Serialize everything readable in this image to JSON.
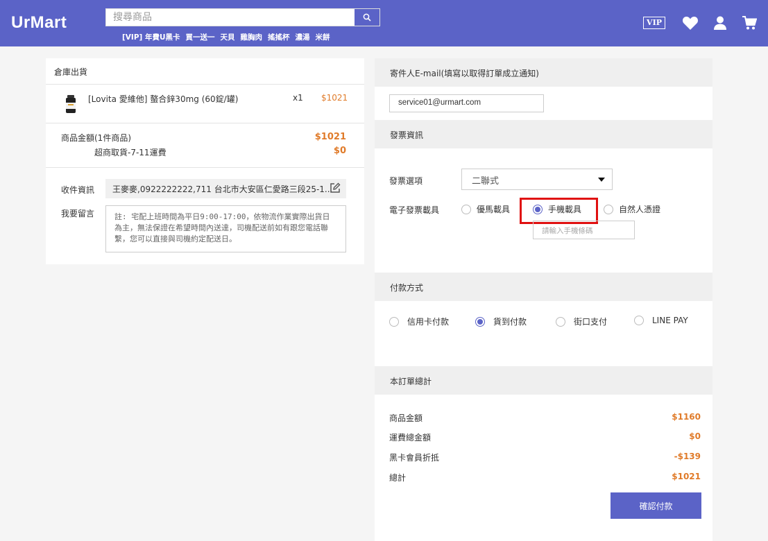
{
  "header": {
    "logo": "UrMart",
    "search_placeholder": "搜尋商品",
    "hot_keywords": [
      "[VIP] 年費U黑卡",
      "買一送一",
      "天貝",
      "雞胸肉",
      "搖搖杯",
      "濃湯",
      "米餅"
    ],
    "vip_label": "VIP",
    "icons": [
      "search-icon",
      "vip-icon",
      "heart-icon",
      "user-icon",
      "cart-icon"
    ],
    "bg_color": "#5b63c7"
  },
  "order": {
    "section_title": "倉庫出貨",
    "product": {
      "name": "[Lovita 愛維他] 螯合鋅30mg (60錠/罐)",
      "qty": "x1",
      "price": "$1021"
    },
    "subtotal_label": "商品金額(1件商品)",
    "subtotal_value": "$1021",
    "shipping_label": "超商取貨-7-11運費",
    "shipping_value": "$0",
    "receiver_label": "收件資訊",
    "receiver_value": "王麥麥,0922222222,711 台北市大安區仁愛路三段25-1...",
    "message_label": "我要留言",
    "message_placeholder": "註: 宅配上班時間為平日9:00-17:00，依物流作業實際出貨日為主，無法保證在希望時間內送達，司機配送前如有跟您電話聯繫，您可以直接與司機約定配送日。"
  },
  "email": {
    "title": "寄件人E-mail(填寫以取得訂單成立通知)",
    "value": "service01@urmart.com"
  },
  "invoice": {
    "title": "發票資訊",
    "option_label": "發票選項",
    "option_value": "二聯式",
    "carrier_label": "電子發票載具",
    "carriers": [
      {
        "label": "優馬載具",
        "selected": false
      },
      {
        "label": "手機載具",
        "selected": true
      },
      {
        "label": "自然人憑證",
        "selected": false
      }
    ],
    "phone_placeholder": "請輸入手機條碼"
  },
  "payment": {
    "title": "付款方式",
    "methods": [
      {
        "label": "信用卡付款",
        "selected": false
      },
      {
        "label": "貨到付款",
        "selected": true
      },
      {
        "label": "街口支付",
        "selected": false
      },
      {
        "label": "LINE PAY",
        "selected": false
      }
    ]
  },
  "summary": {
    "title": "本訂單總計",
    "rows": [
      {
        "label": "商品金額",
        "value": "$1160"
      },
      {
        "label": "運費總金額",
        "value": "$0"
      },
      {
        "label": "黑卡會員折抵",
        "value": "-$139"
      },
      {
        "label": "總計",
        "value": "$1021"
      }
    ],
    "confirm_label": "確認付款",
    "accent_color": "#e07b2a"
  }
}
